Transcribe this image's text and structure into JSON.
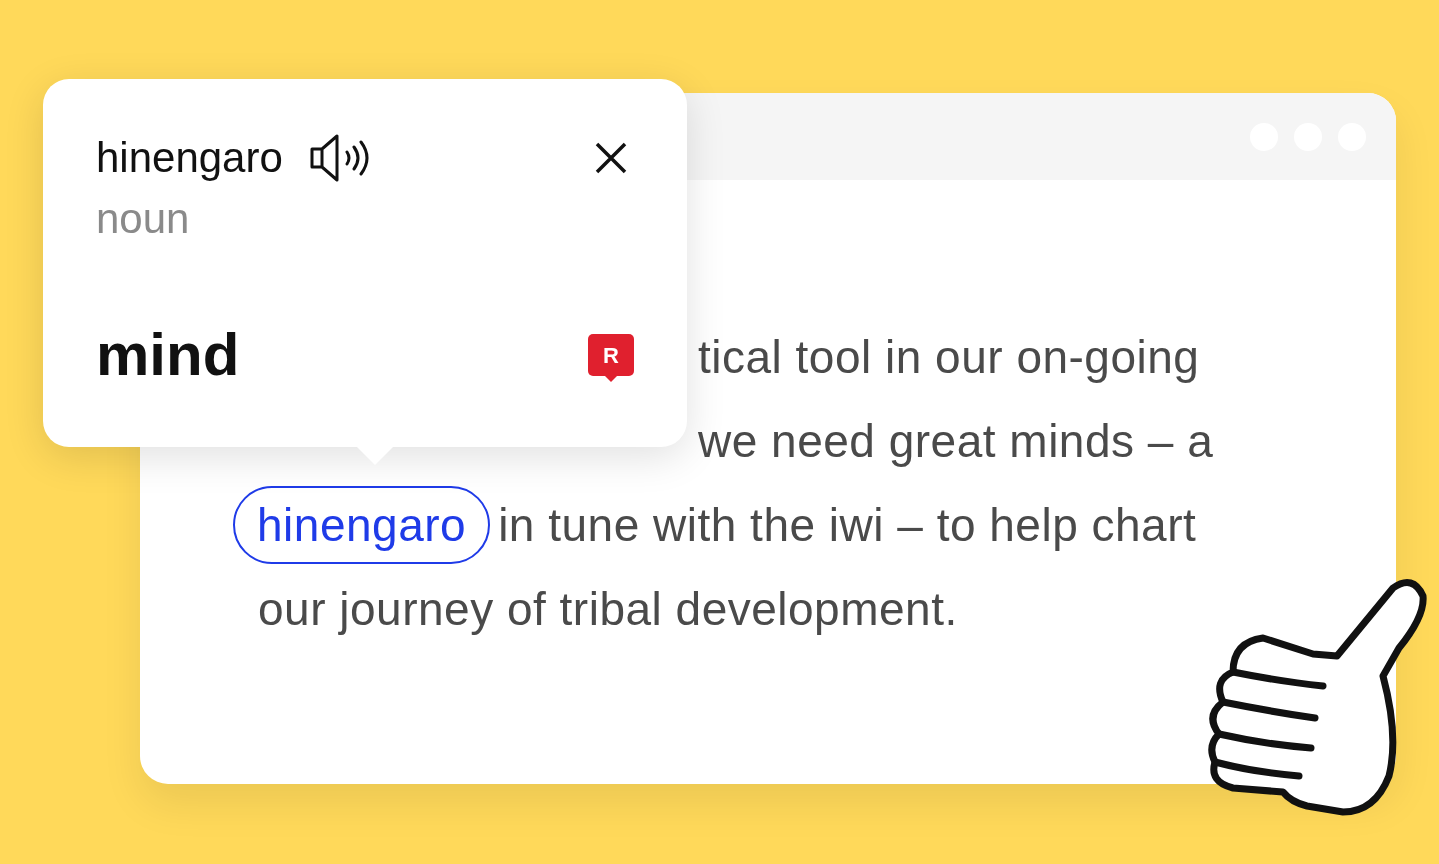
{
  "popup": {
    "word": "hinengaro",
    "part_of_speech": "noun",
    "translation": "mind",
    "badge": "R"
  },
  "paragraph": {
    "lines": [
      {
        "text": "tical tool in our on-going"
      },
      {
        "text": "we need great minds – a"
      },
      {
        "highlight": "hinengaro",
        "text": "in tune with the iwi – to help chart"
      },
      {
        "text": "our journey of tribal development."
      }
    ]
  }
}
